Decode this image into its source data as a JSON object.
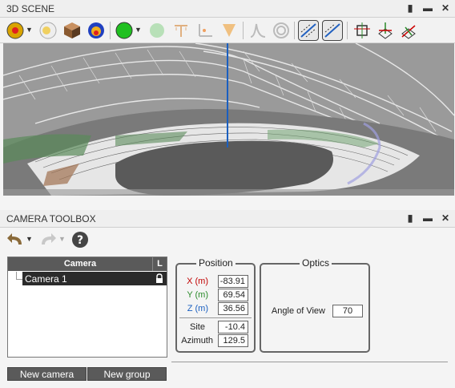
{
  "scene_panel": {
    "title": "3D SCENE"
  },
  "camera_panel": {
    "title": "CAMERA TOOLBOX"
  },
  "window_buttons": {
    "pin": "▮",
    "minimize": "▬",
    "close": "✕"
  },
  "camera_list": {
    "header_name": "Camera",
    "header_lock": "L",
    "items": [
      {
        "label": "Camera 1",
        "locked": true
      }
    ]
  },
  "buttons": {
    "new_camera": "New camera",
    "new_group": "New group"
  },
  "position": {
    "legend": "Position",
    "x_label": "X (m)",
    "x_value": "-83.91",
    "y_label": "Y (m)",
    "y_value": "69.54",
    "z_label": "Z (m)",
    "z_value": "36.56",
    "site_label": "Site",
    "site_value": "-10.4",
    "azimuth_label": "Azimuth",
    "azimuth_value": "129.5"
  },
  "optics": {
    "legend": "Optics",
    "angle_label": "Angle of View",
    "angle_value": "70"
  },
  "colors": {
    "x_axis": "#c00000",
    "y_axis": "#2a8a2a",
    "z_axis": "#1a5fc0",
    "list_header": "#5a5a5a"
  }
}
